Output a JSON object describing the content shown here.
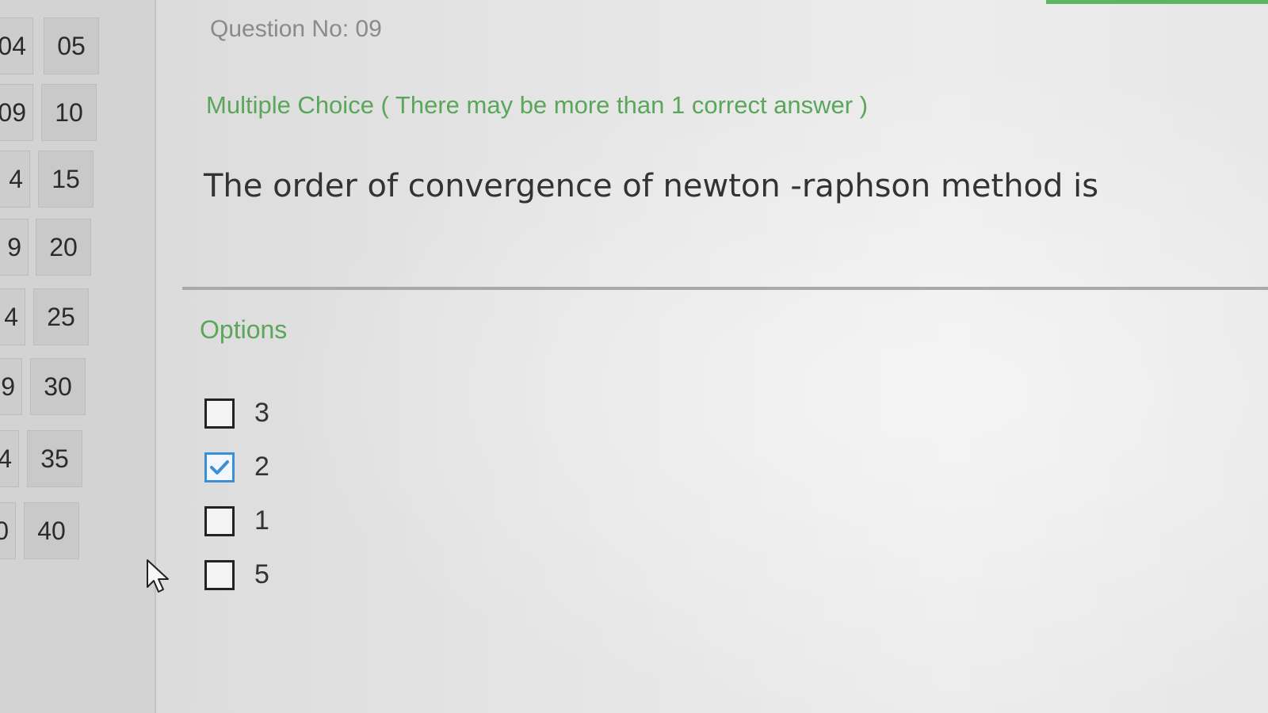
{
  "navigator": {
    "rows": [
      [
        "04",
        "05"
      ],
      [
        "09",
        "10"
      ],
      [
        "4",
        "15"
      ],
      [
        "9",
        "20"
      ],
      [
        "4",
        "25"
      ],
      [
        "9",
        "30"
      ],
      [
        "4",
        "35"
      ],
      [
        "0",
        "40"
      ]
    ]
  },
  "question": {
    "number_label": "Question No: 09",
    "type_label": "Multiple Choice ( There may be more than 1 correct answer )",
    "text": "The order of convergence of newton -raphson  method is"
  },
  "options": {
    "heading": "Options",
    "items": [
      {
        "label": "3",
        "checked": false
      },
      {
        "label": "2",
        "checked": true
      },
      {
        "label": "1",
        "checked": false
      },
      {
        "label": "5",
        "checked": false
      }
    ]
  },
  "colors": {
    "accent_green": "#5aa65a",
    "checkbox_checked": "#3a8fd6"
  }
}
